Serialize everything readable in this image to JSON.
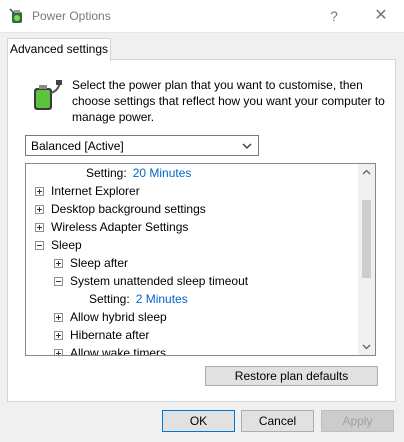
{
  "window": {
    "title": "Power Options",
    "help_glyph": "?",
    "close_glyph": "✕"
  },
  "tab": {
    "label": "Advanced settings"
  },
  "intro": {
    "text": "Select the power plan that you want to customise, then choose settings that reflect how you want your computer to manage power."
  },
  "plan_select": {
    "value": "Balanced [Active]"
  },
  "tree": {
    "items": [
      {
        "type": "setting",
        "label": "Setting:",
        "value": "20 Minutes"
      },
      {
        "type": "node",
        "label": "Internet Explorer",
        "expanded": false
      },
      {
        "type": "node",
        "label": "Desktop background settings",
        "expanded": false
      },
      {
        "type": "node",
        "label": "Wireless Adapter Settings",
        "expanded": false
      },
      {
        "type": "node",
        "label": "Sleep",
        "expanded": true
      },
      {
        "type": "node",
        "label": "Sleep after",
        "expanded": false
      },
      {
        "type": "node",
        "label": "System unattended sleep timeout",
        "expanded": true
      },
      {
        "type": "setting",
        "label": "Setting:",
        "value": "2 Minutes"
      },
      {
        "type": "node",
        "label": "Allow hybrid sleep",
        "expanded": false
      },
      {
        "type": "node",
        "label": "Hibernate after",
        "expanded": false
      },
      {
        "type": "node",
        "label": "Allow wake timers",
        "expanded": false
      }
    ]
  },
  "buttons": {
    "restore": "Restore plan defaults",
    "ok": "OK",
    "cancel": "Cancel",
    "apply": "Apply"
  },
  "colors": {
    "link_value": "#0066cc",
    "ok_border": "#0078d7",
    "disabled_text": "#a0a0a0"
  },
  "icons": {
    "app": "power-options-icon",
    "battery": "battery-plug-icon",
    "expander_collapsed": "plus-box-icon",
    "expander_expanded": "minus-box-icon"
  }
}
